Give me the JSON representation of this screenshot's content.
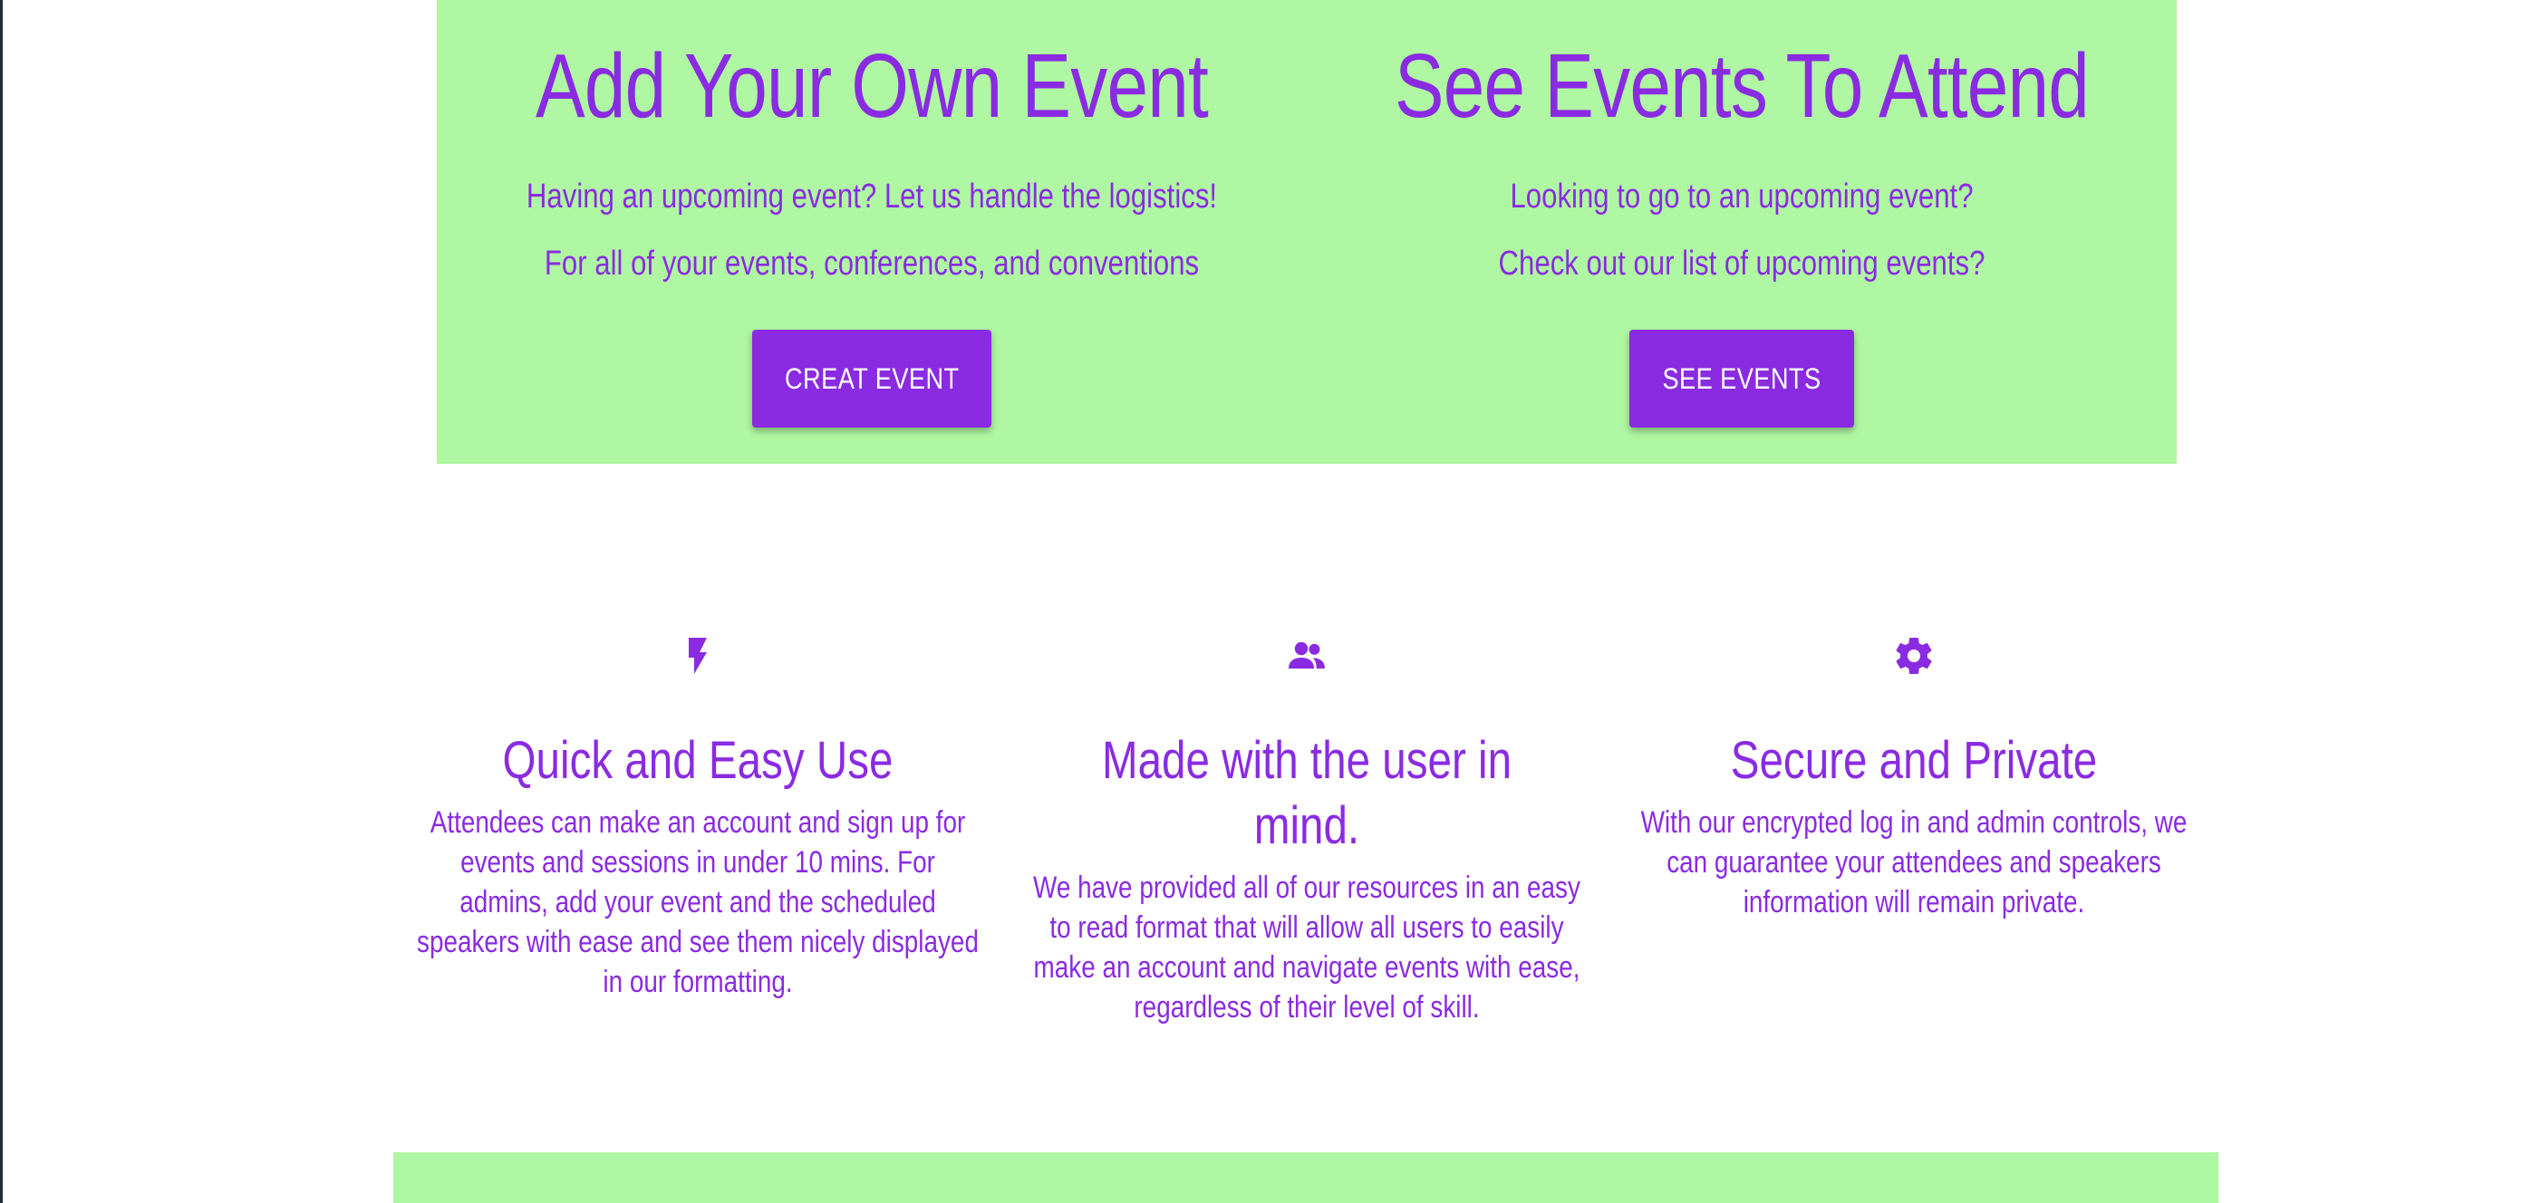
{
  "colors": {
    "accent": "#8a2be2",
    "hero_bg": "#b0f7a3",
    "button_text": "#ffffff"
  },
  "hero": {
    "create": {
      "title": "Add Your Own Event",
      "line1": "Having an upcoming event? Let us handle the logistics!",
      "line2": "For all of your events, conferences, and conventions",
      "button_label": "CREAT EVENT"
    },
    "attend": {
      "title": "See Events To Attend",
      "line1": "Looking to go to an upcoming event?",
      "line2": "Check out our list of upcoming events?",
      "button_label": "SEE EVENTS"
    }
  },
  "features": [
    {
      "icon": "lightning-bolt-icon",
      "title": "Quick and Easy Use",
      "text": "Attendees can make an account and sign up for events and sessions in under 10 mins. For admins, add your event and the scheduled speakers with ease and see them nicely displayed in our formatting."
    },
    {
      "icon": "people-icon",
      "title": "Made with the user in mind.",
      "text": "We have provided all of our resources in an easy to read format that will allow all users to easily make an account and navigate events with ease, regardless of their level of skill."
    },
    {
      "icon": "gear-icon",
      "title": "Secure and Private",
      "text": "With our encrypted log in and admin controls, we can guarantee your attendees and speakers information will remain private."
    }
  ]
}
